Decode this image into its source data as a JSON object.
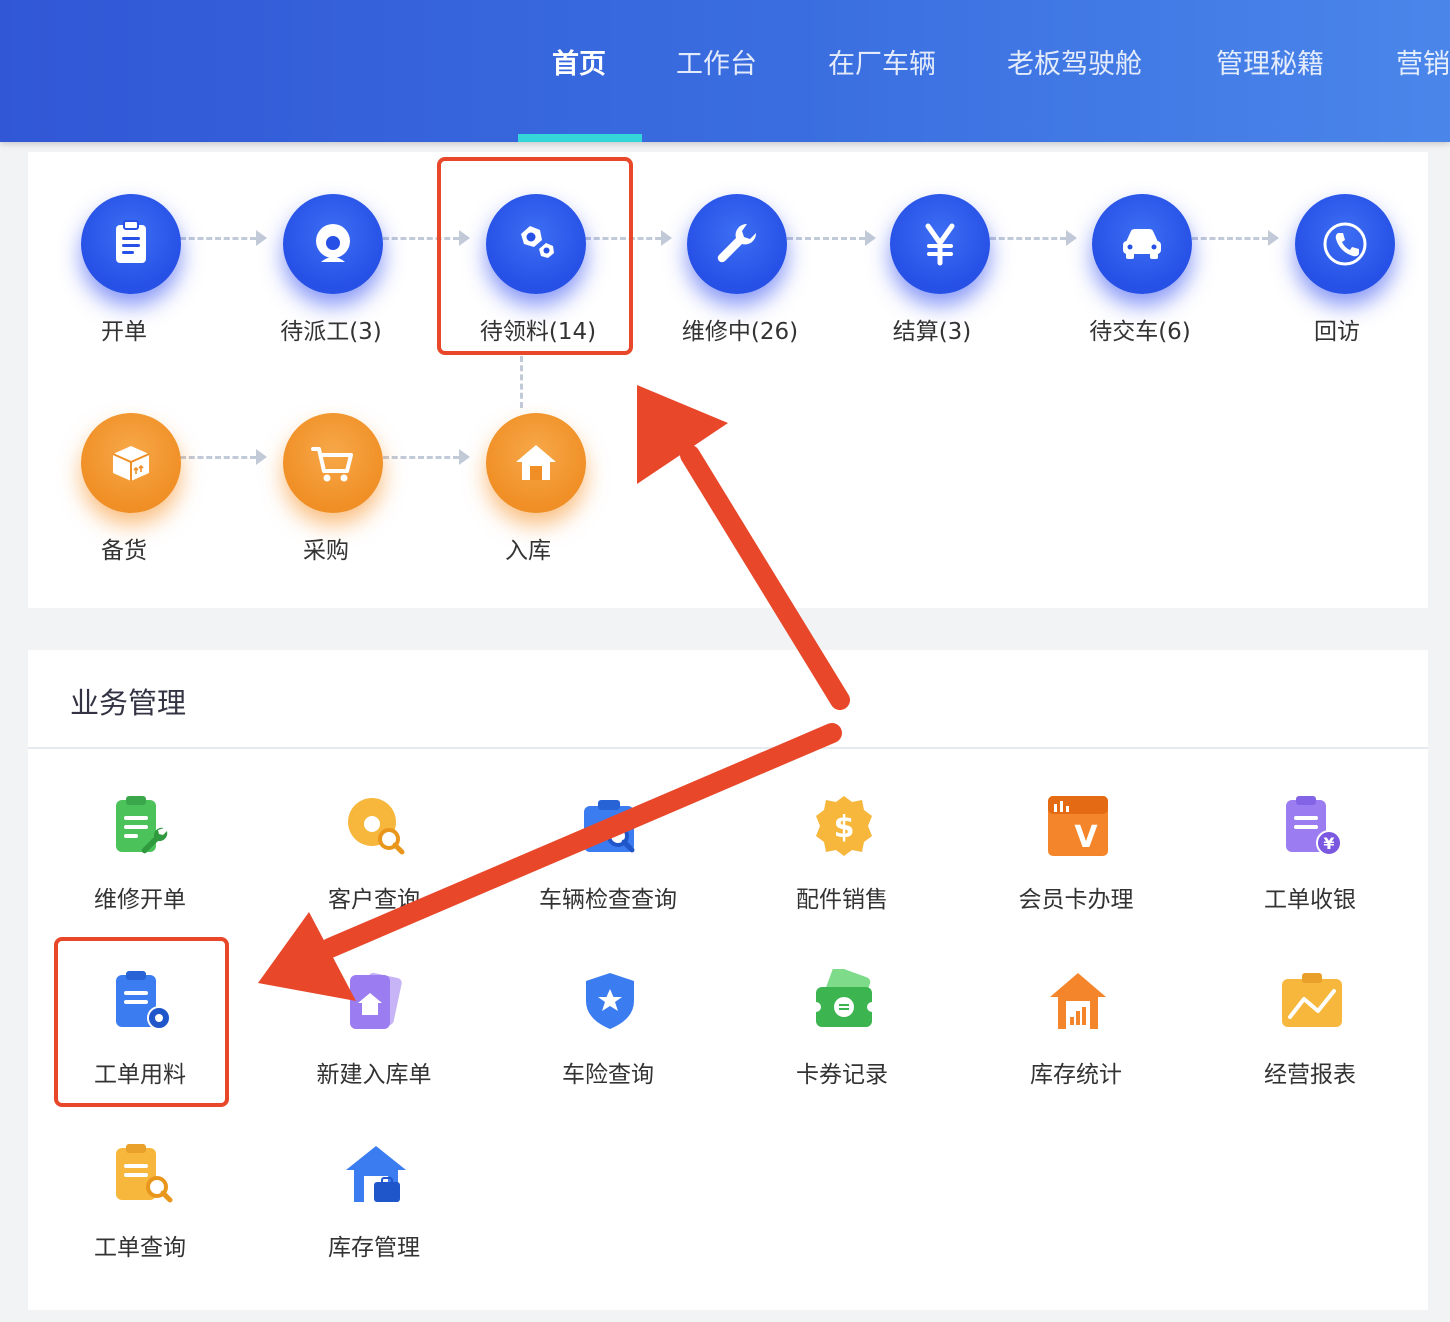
{
  "nav": {
    "items": [
      "首页",
      "工作台",
      "在厂车辆",
      "老板驾驶舱",
      "管理秘籍",
      "营销"
    ],
    "active": "首页"
  },
  "flow": {
    "row1": [
      {
        "label": "开单",
        "icon": "clipboard-icon"
      },
      {
        "label": "待派工(3)",
        "icon": "mechanic-icon"
      },
      {
        "label": "待领料(14)",
        "icon": "parts-icon"
      },
      {
        "label": "维修中(26)",
        "icon": "wrench-icon"
      },
      {
        "label": "结算(3)",
        "icon": "yen-icon"
      },
      {
        "label": "待交车(6)",
        "icon": "car-icon"
      },
      {
        "label": "回访",
        "icon": "phone-icon"
      }
    ],
    "row2": [
      {
        "label": "备货",
        "icon": "box-icon"
      },
      {
        "label": "采购",
        "icon": "cart-icon"
      },
      {
        "label": "入库",
        "icon": "warehouse-icon"
      }
    ]
  },
  "business": {
    "title": "业务管理",
    "items": [
      {
        "label": "维修开单",
        "icon": "repair-order-icon"
      },
      {
        "label": "客户查询",
        "icon": "customer-search-icon"
      },
      {
        "label": "车辆检查查询",
        "icon": "vehicle-inspection-icon"
      },
      {
        "label": "配件销售",
        "icon": "parts-sale-icon"
      },
      {
        "label": "会员卡办理",
        "icon": "member-card-icon"
      },
      {
        "label": "工单收银",
        "icon": "order-cashier-icon"
      },
      {
        "label": "工单用料",
        "icon": "order-material-icon"
      },
      {
        "label": "新建入库单",
        "icon": "new-stock-in-icon"
      },
      {
        "label": "车险查询",
        "icon": "insurance-icon"
      },
      {
        "label": "卡券记录",
        "icon": "coupon-icon"
      },
      {
        "label": "库存统计",
        "icon": "stock-stats-icon"
      },
      {
        "label": "经营报表",
        "icon": "report-icon"
      },
      {
        "label": "工单查询",
        "icon": "order-search-icon"
      },
      {
        "label": "库存管理",
        "icon": "stock-manage-icon"
      }
    ]
  },
  "colors": {
    "nav_bg_start": "#3157d6",
    "nav_bg_end": "#4a86ea",
    "nav_active_underline": "#35d6d9",
    "flow_blue": "#2650e6",
    "flow_orange": "#f08f25",
    "annotation_red": "#e8472a"
  }
}
